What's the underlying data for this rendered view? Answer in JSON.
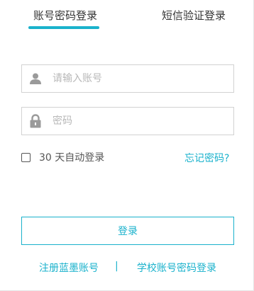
{
  "tabs": {
    "account_login": "账号密码登录",
    "sms_login": "短信验证登录",
    "active": "account_login"
  },
  "form": {
    "username": {
      "value": "",
      "placeholder": "请输入账号",
      "icon": "user-icon"
    },
    "password": {
      "value": "",
      "placeholder": "密码",
      "icon": "lock-icon"
    },
    "remember_me": {
      "checked": false,
      "label": "30 天自动登录"
    },
    "forgot_password": "忘记密码?",
    "submit_label": "登录"
  },
  "footer_links": {
    "register": "注册蓝墨账号",
    "separator": "|",
    "school_login": "学校账号密码登录"
  },
  "colors": {
    "accent": "#1ab2cc",
    "border": "#d2d2d2",
    "placeholder": "#b8b8b8",
    "icon": "#9a9a9a"
  }
}
